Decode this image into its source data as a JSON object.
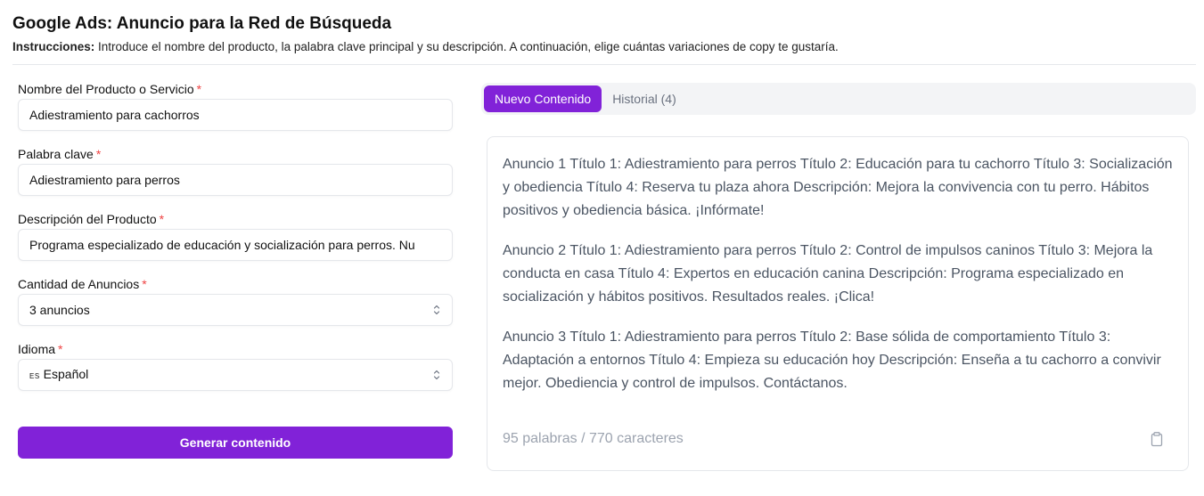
{
  "header": {
    "title": "Google Ads: Anuncio para la Red de Búsqueda",
    "instructions_label": "Instrucciones:",
    "instructions_text": " Introduce el nombre del producto, la palabra clave principal y su descripción. A continuación, elige cuántas variaciones de copy te gustaría."
  },
  "form": {
    "product": {
      "label": "Nombre del Producto o Servicio",
      "required": "*",
      "value": "Adiestramiento para cachorros"
    },
    "keyword": {
      "label": "Palabra clave",
      "required": "*",
      "value": "Adiestramiento para perros"
    },
    "description": {
      "label": "Descripción del Producto",
      "required": "*",
      "value": "Programa especializado de educación y socialización para perros. Nu"
    },
    "quantity": {
      "label": "Cantidad de Anuncios",
      "required": "*",
      "value": "3 anuncios"
    },
    "language": {
      "label": "Idioma",
      "required": "*",
      "flag": "ES",
      "value": "Español"
    },
    "generate_label": "Generar contenido"
  },
  "tabs": [
    {
      "label": "Nuevo Contenido",
      "active": true
    },
    {
      "label": "Historial (4)",
      "active": false
    }
  ],
  "output": {
    "ads": [
      "Anuncio 1 Título 1: Adiestramiento para perros Título 2: Educación para tu cachorro Título 3: Socialización y obediencia Título 4: Reserva tu plaza ahora Descripción: Mejora la convivencia con tu perro. Hábitos positivos y obediencia básica. ¡Infórmate!",
      "Anuncio 2 Título 1: Adiestramiento para perros Título 2: Control de impulsos caninos Título 3: Mejora la conducta en casa Título 4: Expertos en educación canina Descripción: Programa especializado en socialización y hábitos positivos. Resultados reales. ¡Clica!",
      "Anuncio 3 Título 1: Adiestramiento para perros Título 2: Base sólida de comportamiento Título 3: Adaptación a entornos Título 4: Empieza su educación hoy Descripción: Enseña a tu cachorro a convivir mejor. Obediencia y control de impulsos. Contáctanos."
    ],
    "word_count": "95 palabras / 770 caracteres"
  },
  "colors": {
    "accent": "#8122d8",
    "required": "#ef4444",
    "muted_text": "#9ca3af",
    "body_text": "#4b5563"
  },
  "icons": {
    "select_chevron": "chevron-up-down-icon",
    "copy": "clipboard-icon"
  }
}
